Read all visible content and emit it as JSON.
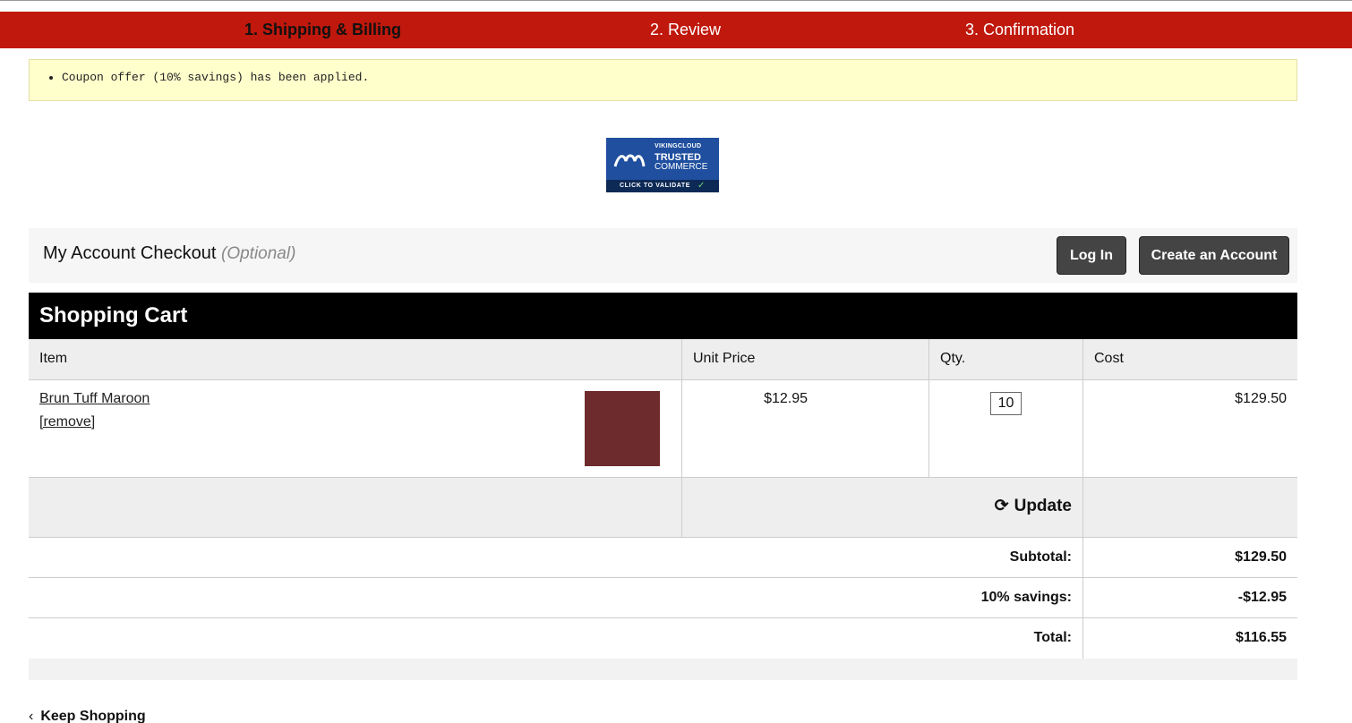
{
  "steps": [
    {
      "label": "1. Shipping & Billing",
      "active": true
    },
    {
      "label": "2. Review",
      "active": false
    },
    {
      "label": "3. Confirmation",
      "active": false
    }
  ],
  "notice": {
    "message": "Coupon offer (10% savings) has been applied."
  },
  "trust_badge": {
    "brand": "VIKINGCLOUD",
    "line1": "TRUSTED",
    "line2": "COMMERCE",
    "cta": "CLICK TO VALIDATE",
    "icon": "checkmark-icon"
  },
  "account": {
    "title": "My Account Checkout",
    "optional": "(Optional)",
    "login_label": "Log In",
    "create_label": "Create an Account"
  },
  "cart": {
    "title": "Shopping Cart",
    "columns": [
      "Item",
      "Unit Price",
      "Qty.",
      "Cost"
    ],
    "items": [
      {
        "name": "Brun Tuff Maroon",
        "remove_label": "[remove]",
        "swatch_color": "#6e2b2d",
        "unit_price": "$12.95",
        "qty": "10",
        "cost": "$129.50"
      }
    ],
    "update_label": "Update",
    "update_icon": "refresh-icon",
    "totals": [
      {
        "label": "Subtotal:",
        "value": "$129.50"
      },
      {
        "label": "10% savings:",
        "value": "-$12.95"
      },
      {
        "label": "Total:",
        "value": "$116.55"
      }
    ]
  },
  "keep_shopping": {
    "label": "Keep Shopping",
    "icon": "chevron-left-icon"
  },
  "colors": {
    "step_bar": "#c0180c",
    "notice_bg": "#ffffcc",
    "button_bg": "#444444",
    "cart_header_bg": "#000000"
  }
}
